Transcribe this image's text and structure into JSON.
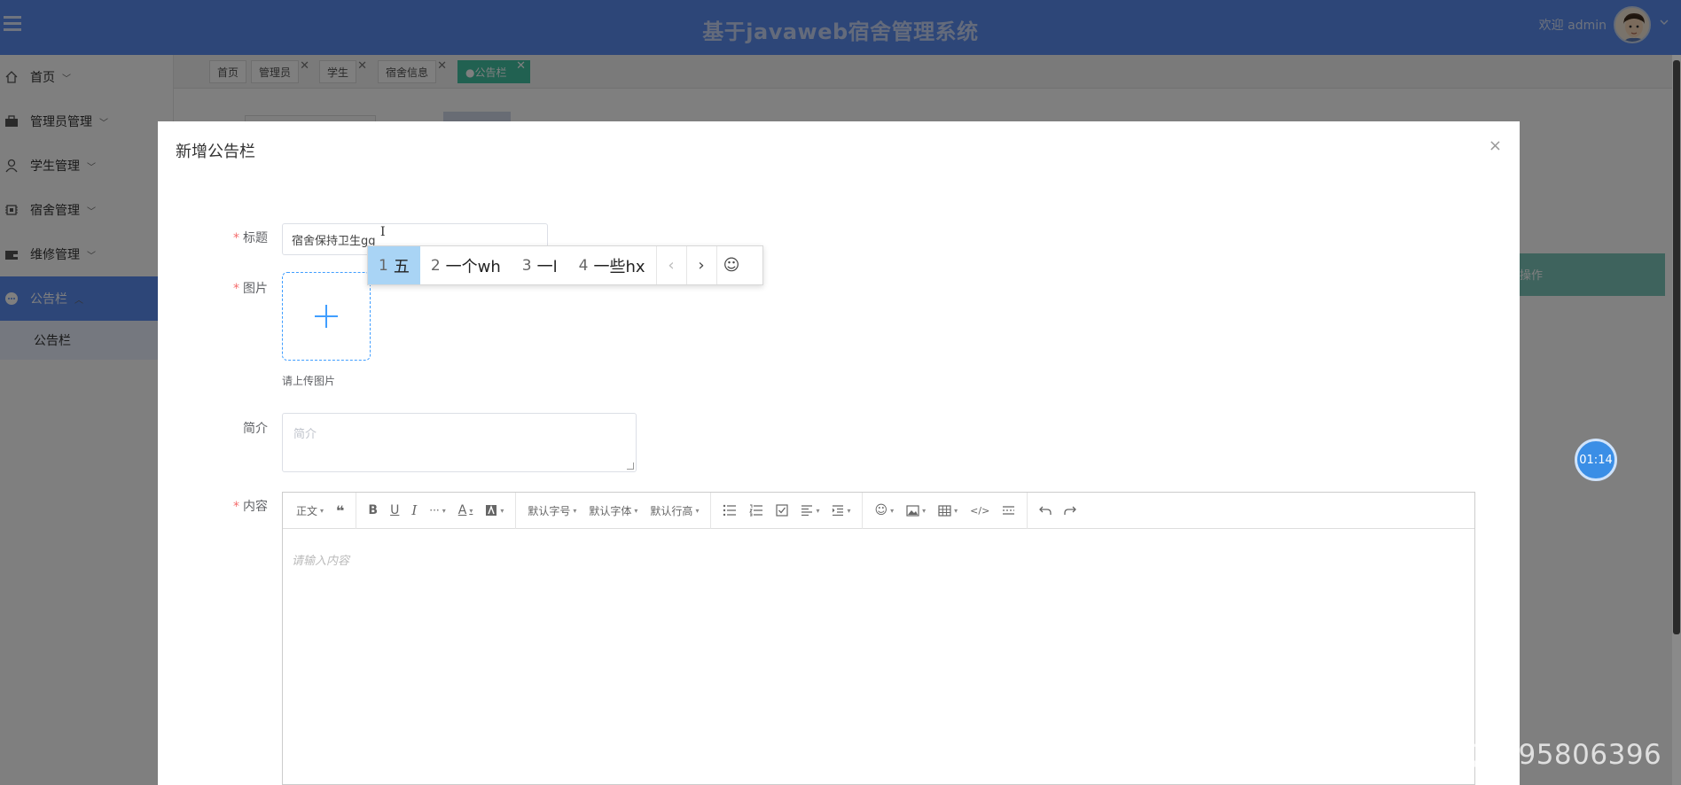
{
  "header": {
    "title": "基于javaweb宿舍管理系统",
    "welcome": "欢迎 admin"
  },
  "sidebar": {
    "items": [
      {
        "label": "首页",
        "icon": "home-icon"
      },
      {
        "label": "管理员管理",
        "icon": "briefcase-icon"
      },
      {
        "label": "学生管理",
        "icon": "user-icon"
      },
      {
        "label": "宿舍管理",
        "icon": "chip-icon"
      },
      {
        "label": "维修管理",
        "icon": "wallet-icon"
      },
      {
        "label": "公告栏",
        "icon": "chat-icon",
        "active": true
      }
    ],
    "subitem": "公告栏"
  },
  "tabs": [
    {
      "label": "首页"
    },
    {
      "label": "管理员"
    },
    {
      "label": "学生"
    },
    {
      "label": "宿舍信息"
    },
    {
      "label": "●公告栏",
      "active": true
    }
  ],
  "background": {
    "table_header_op": "操作"
  },
  "modal": {
    "title": "新增公告栏",
    "close": "×",
    "fields": {
      "title_label": "标题",
      "title_value": "宿舍保持卫生gg",
      "image_label": "图片",
      "upload_tip": "请上传图片",
      "intro_label": "简介",
      "intro_placeholder": "简介",
      "content_label": "内容",
      "content_placeholder": "请输入内容"
    },
    "toolbar": {
      "heading": "正文",
      "font_size": "默认字号",
      "font_family": "默认字体",
      "line_height": "默认行高"
    }
  },
  "ime": {
    "candidates": [
      {
        "n": "1",
        "text": "五",
        "selected": true
      },
      {
        "n": "2",
        "text": "一个wh"
      },
      {
        "n": "3",
        "text": "一l"
      },
      {
        "n": "4",
        "text": "一些hx"
      }
    ]
  },
  "timer": "01:14",
  "watermark": "CSDN @QQ1795806396",
  "colors": {
    "primary": "#5a8cf0",
    "tab_active": "#43c2a3",
    "required": "#f56c6c",
    "ime_selected": "#a9d4f5"
  }
}
